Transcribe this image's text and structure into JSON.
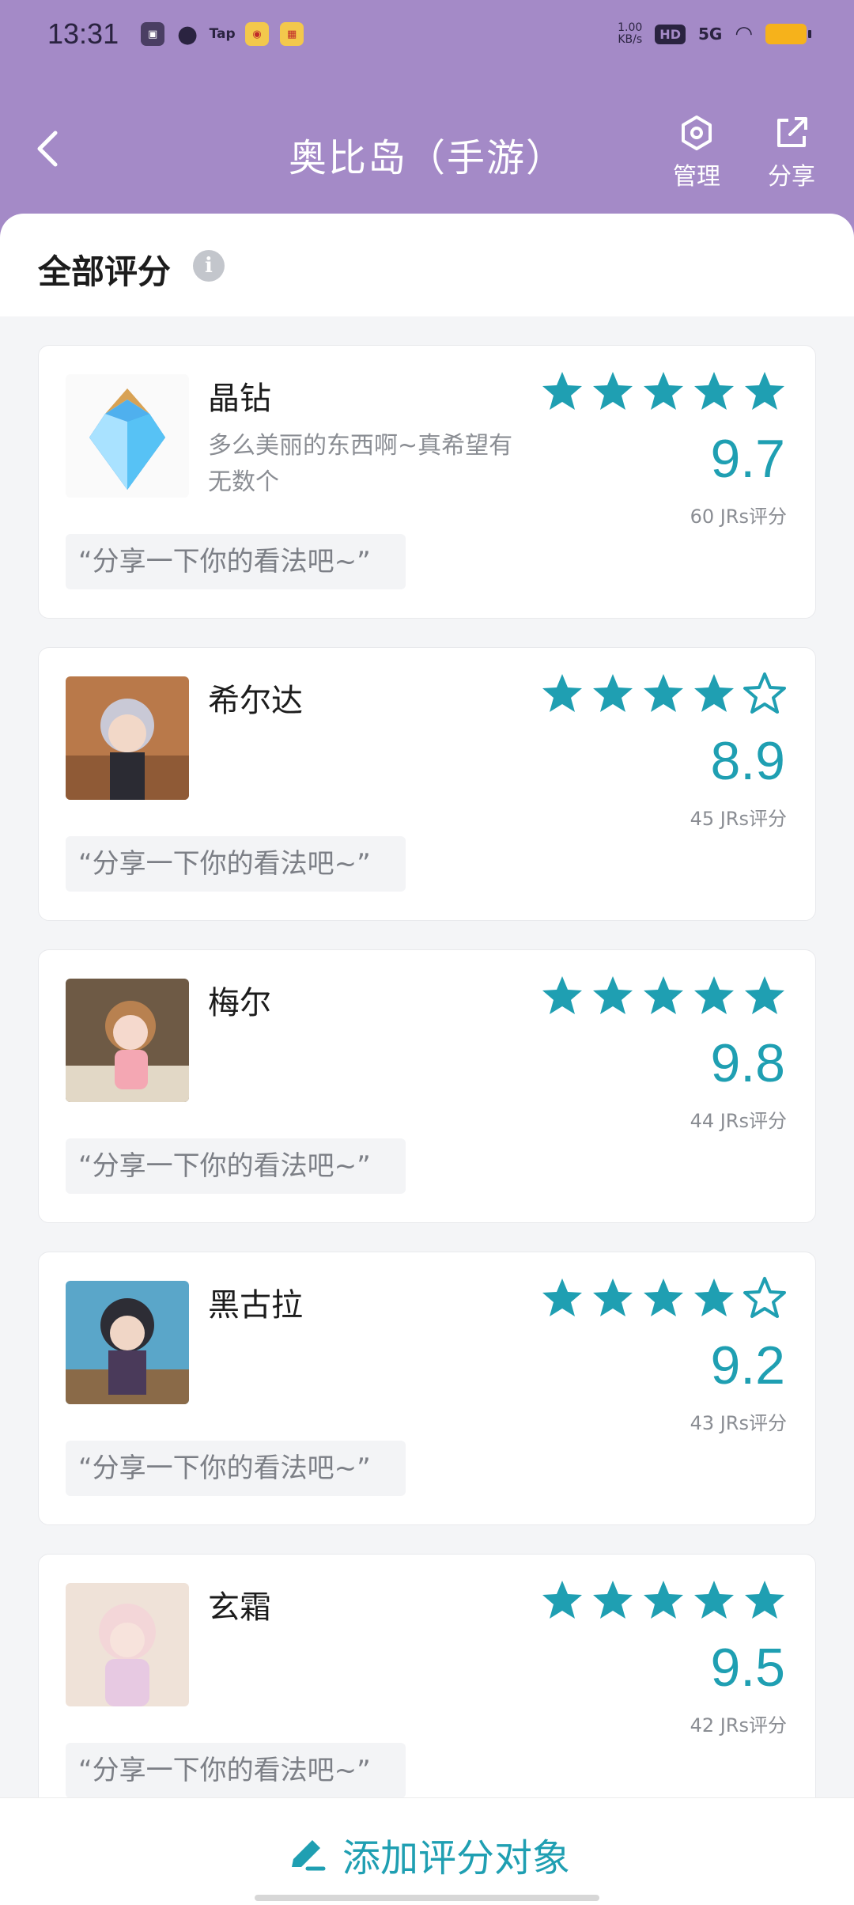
{
  "status_bar": {
    "time": "13:31",
    "net_speed": "1.00",
    "net_unit": "KB/s",
    "hd": "HD",
    "signal": "5G"
  },
  "nav": {
    "title": "奥比岛（手游）",
    "manage_label": "管理",
    "share_label": "分享"
  },
  "section": {
    "title": "全部评分"
  },
  "colors": {
    "accent": "#1f9fb2",
    "header": "#a48ac7"
  },
  "items": [
    {
      "name": "晶钻",
      "desc": "多么美丽的东西啊~真希望有无数个",
      "rating_stars": 5,
      "score": "9.7",
      "count": "60 JRs评分",
      "share": "“分享一下你的看法吧~”"
    },
    {
      "name": "希尔达",
      "desc": "",
      "rating_stars": 4,
      "score": "8.9",
      "count": "45 JRs评分",
      "share": "“分享一下你的看法吧~”"
    },
    {
      "name": "梅尔",
      "desc": "",
      "rating_stars": 5,
      "score": "9.8",
      "count": "44 JRs评分",
      "share": "“分享一下你的看法吧~”"
    },
    {
      "name": "黑古拉",
      "desc": "",
      "rating_stars": 4,
      "score": "9.2",
      "count": "43 JRs评分",
      "share": "“分享一下你的看法吧~”"
    },
    {
      "name": "玄霜",
      "desc": "",
      "rating_stars": 5,
      "score": "9.5",
      "count": "42 JRs评分",
      "share": "“分享一下你的看法吧~”"
    }
  ],
  "bottom": {
    "add_label": "添加评分对象"
  }
}
